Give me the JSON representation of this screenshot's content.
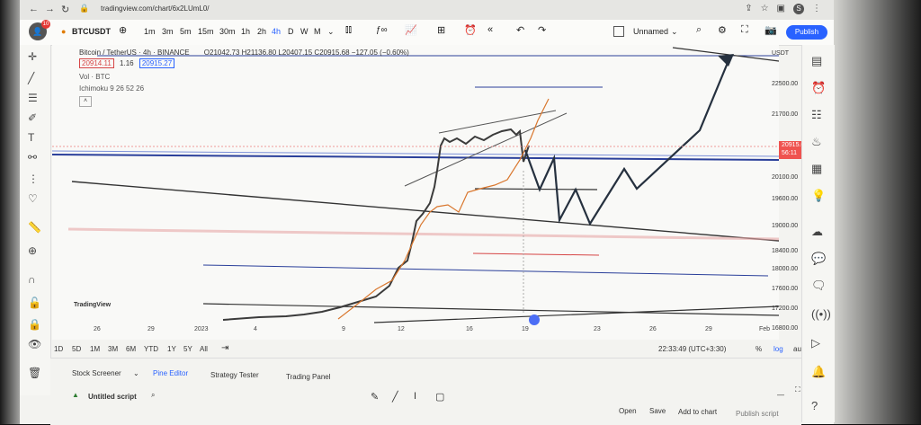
{
  "browser": {
    "url": "tradingview.com/chart/6x2LUmL0/",
    "profile_initial": "S"
  },
  "toolbar": {
    "logo_badge": "10",
    "symbol": "BTCUSDT",
    "intervals": [
      "1m",
      "3m",
      "5m",
      "15m",
      "30m",
      "1h",
      "2h",
      "4h",
      "D",
      "W",
      "M"
    ],
    "active_interval": "4h",
    "layout_name": "Unnamed",
    "publish_label": "Publish"
  },
  "legend": {
    "title": "Bitcoin / TetherUS · 4h · BINANCE",
    "ohlc": "O21042.73 H21136.80 L20407.15 C20915.68 −127.05 (−0.60%)",
    "bid": "20914.11",
    "spread": "1.16",
    "ask": "20915.27",
    "vol": "Vol · BTC",
    "ichimoku": "Ichimoku 9 26 52 26"
  },
  "price_axis": {
    "currency": "USDT",
    "labels": [
      "22500.00",
      "21700.00",
      "20100.00",
      "19600.00",
      "19000.00",
      "18400.00",
      "18000.00",
      "17600.00",
      "17200.00",
      "16800.00"
    ],
    "current_price": "20915.68",
    "countdown": "56:11"
  },
  "time_axis": {
    "labels": [
      "26",
      "29",
      "2023",
      "4",
      "9",
      "12",
      "16",
      "19",
      "23",
      "26",
      "29",
      "Feb"
    ]
  },
  "range_bar": {
    "ranges": [
      "1D",
      "5D",
      "1M",
      "3M",
      "6M",
      "YTD",
      "1Y",
      "5Y",
      "All"
    ],
    "clock": "22:33:49 (UTC+3:30)",
    "percent": "%",
    "log": "log",
    "auto": "auto"
  },
  "bottom_panel": {
    "tabs": [
      "Stock Screener",
      "Pine Editor",
      "Strategy Tester",
      "Trading Panel"
    ],
    "script_title": "Untitled script",
    "actions": [
      "Open",
      "Save",
      "Add to chart",
      "Publish script"
    ]
  },
  "watermark": "TradingView"
}
